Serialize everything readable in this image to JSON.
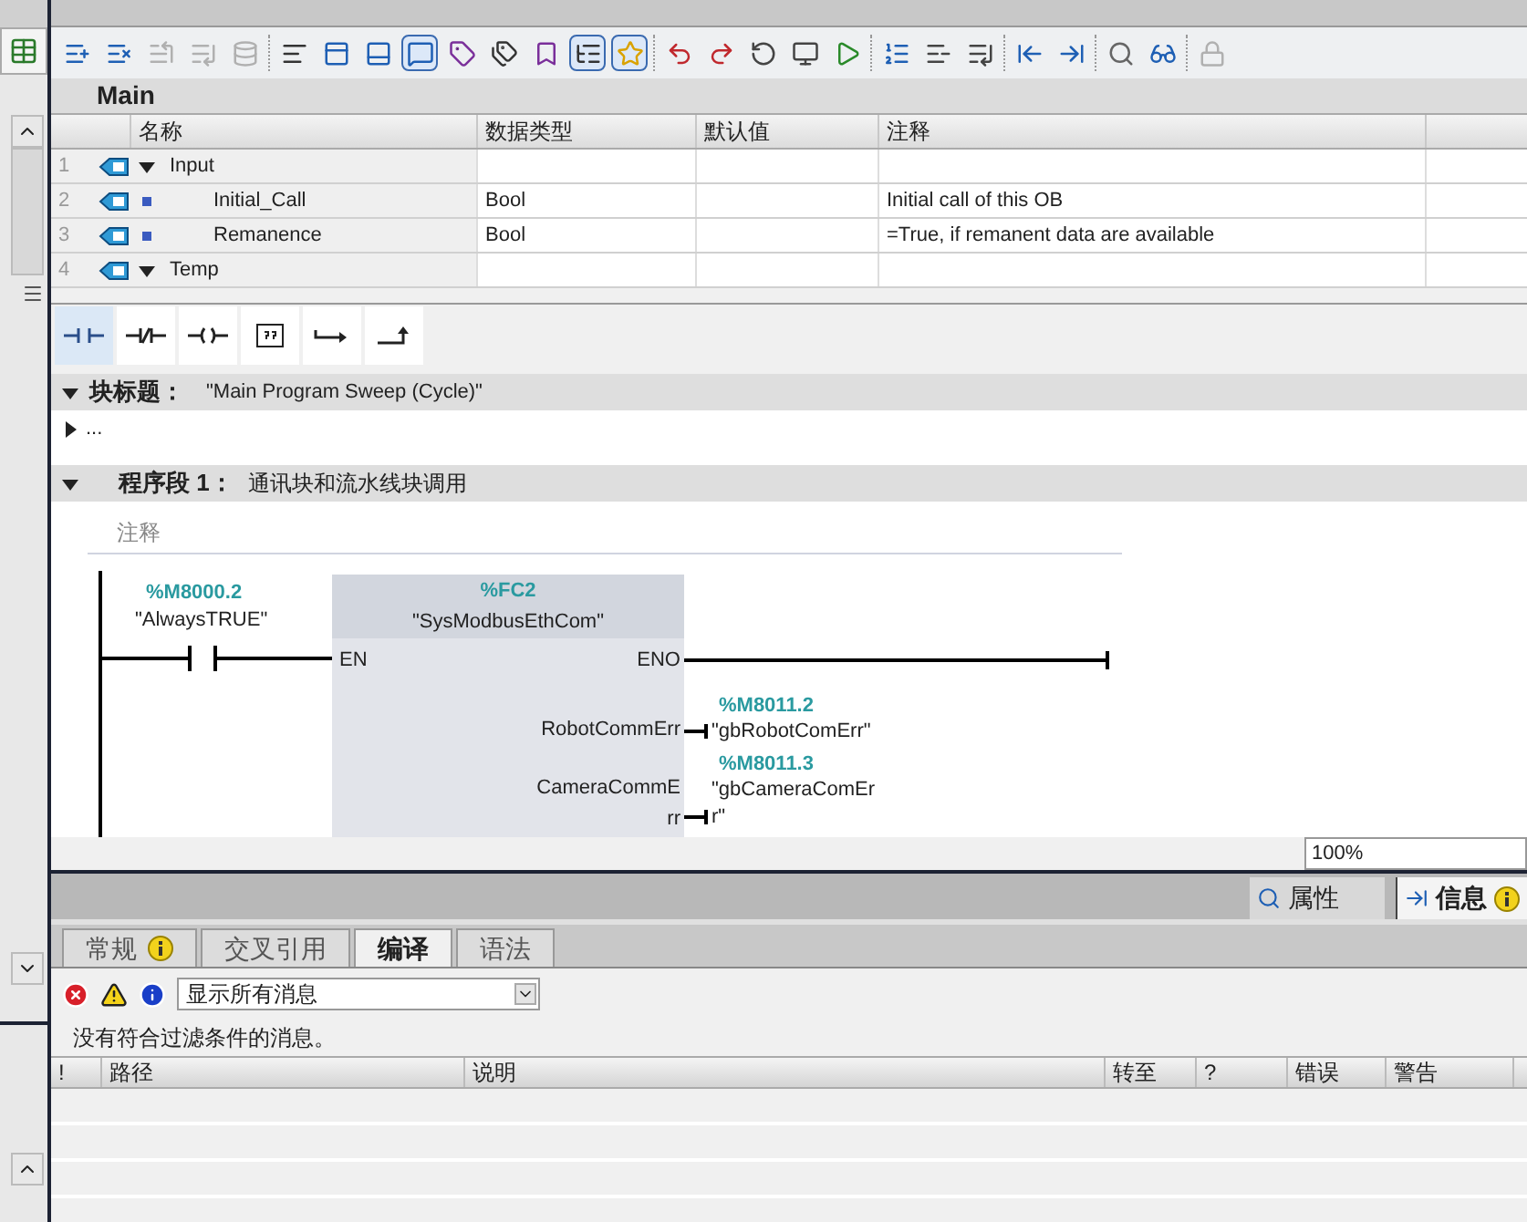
{
  "toolbar": [
    {
      "pressed": false,
      "disabled": false
    },
    {
      "pressed": false,
      "disabled": false
    },
    {
      "pressed": false,
      "disabled": true
    },
    {
      "pressed": false,
      "disabled": true
    },
    {
      "pressed": false,
      "disabled": true
    },
    {
      "pressed": false,
      "disabled": false
    },
    {
      "pressed": false,
      "disabled": false
    },
    {
      "pressed": false,
      "disabled": false
    },
    {
      "pressed": true,
      "disabled": false
    },
    {
      "pressed": false,
      "disabled": false
    },
    {
      "pressed": false,
      "disabled": false
    },
    {
      "pressed": false,
      "disabled": false
    },
    {
      "pressed": true,
      "disabled": false
    },
    {
      "pressed": true,
      "disabled": false
    },
    {
      "pressed": false,
      "disabled": false
    },
    {
      "pressed": false,
      "disabled": false
    },
    {
      "pressed": false,
      "disabled": false
    },
    {
      "pressed": false,
      "disabled": false
    },
    {
      "pressed": false,
      "disabled": false
    },
    {
      "pressed": false,
      "disabled": false
    },
    {
      "pressed": false,
      "disabled": false
    },
    {
      "pressed": false,
      "disabled": false
    },
    {
      "pressed": false,
      "disabled": false
    },
    {
      "pressed": false,
      "disabled": false
    },
    {
      "pressed": false,
      "disabled": false
    },
    {
      "pressed": false,
      "disabled": false
    },
    {
      "pressed": false,
      "disabled": true
    }
  ],
  "block_name": "Main",
  "interface": {
    "columns": [
      "名称",
      "数据类型",
      "默认值",
      "注释"
    ],
    "rows": [
      {
        "number": "1",
        "kind": "section",
        "expanded": true,
        "name": "Input"
      },
      {
        "number": "2",
        "kind": "variable",
        "name": "Initial_Call",
        "data_type": "Bool",
        "comment": "Initial call of this OB"
      },
      {
        "number": "3",
        "kind": "variable",
        "name": "Remanence",
        "data_type": "Bool",
        "comment": "=True, if remanent data are available"
      },
      {
        "number": "4",
        "kind": "section",
        "expanded": true,
        "name": "Temp"
      }
    ]
  },
  "instructions": [
    {
      "kind": "no-contact",
      "selected": true
    },
    {
      "kind": "nc-contact",
      "selected": false
    },
    {
      "kind": "coil",
      "selected": false
    },
    {
      "kind": "empty-box",
      "selected": false
    },
    {
      "kind": "branch-open",
      "selected": false
    },
    {
      "kind": "branch-close",
      "selected": false
    }
  ],
  "block_title": {
    "label": "块标题：",
    "value": "\"Main Program Sweep (Cycle)\"",
    "expanded": true
  },
  "block_comment": {
    "text": "...",
    "expanded": false
  },
  "network": {
    "label": "程序段 1：",
    "title": "通讯块和流水线块调用",
    "expanded": true,
    "comment_placeholder": "注释",
    "contact": {
      "address": "%M8000.2",
      "tag": "\"AlwaysTRUE\""
    },
    "block": {
      "address": "%FC2",
      "name": "\"SysModbusEthCom\"",
      "input": "EN",
      "outputs": [
        {
          "pin": "ENO"
        },
        {
          "pin": "RobotCommErr",
          "address": "%M8011.2",
          "tag": "\"gbRobotComErr\""
        },
        {
          "pin": "CameraCommE\nrr",
          "address": "%M8011.3",
          "tag": "\"gbCameraComEr\nr\""
        }
      ]
    }
  },
  "zoom": "100%",
  "inspector_tabs": [
    {
      "label": "属性",
      "selected": false
    },
    {
      "label": "信息",
      "selected": true
    }
  ],
  "info_tabs": [
    {
      "label": "常规",
      "selected": false,
      "info": true
    },
    {
      "label": "交叉引用",
      "selected": false,
      "info": false
    },
    {
      "label": "编译",
      "selected": true,
      "info": false
    },
    {
      "label": "语法",
      "selected": false,
      "info": false
    }
  ],
  "filter": "显示所有消息",
  "message": "没有符合过滤条件的消息。",
  "message_columns": [
    "!",
    "路径",
    "说明",
    "转至",
    "?",
    "错误",
    "警告"
  ]
}
